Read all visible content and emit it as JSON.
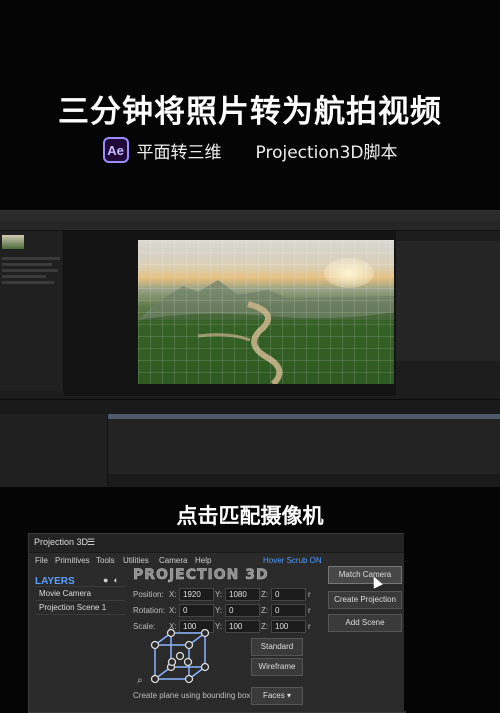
{
  "header": {
    "title": "三分钟将照片转为航拍视频",
    "ae_logo": "Ae",
    "subtitle_left": "平面转三维",
    "subtitle_right": "Projection3D脚本"
  },
  "caption": "点击匹配摄像机",
  "projection_panel": {
    "window_title": "Projection 3D",
    "hamburger_icon": "☰",
    "menu": [
      "File",
      "Primitives",
      "Tools",
      "Utilities",
      "Camera",
      "Help"
    ],
    "hover_scrub": "Hover Scrub ON",
    "layers_title": "LAYERS",
    "layers": [
      "Movie Camera",
      "Projection Scene 1"
    ],
    "logo_text": "PROJECTION 3D",
    "position_label": "Position:",
    "rotation_label": "Rotation:",
    "scale_label": "Scale:",
    "position": {
      "x": "1920",
      "y": "1080",
      "z": "0"
    },
    "rotation": {
      "x": "0",
      "y": "0",
      "z": "0"
    },
    "scale": {
      "x": "100",
      "y": "100",
      "z": "100"
    },
    "axis_x": "X:",
    "axis_y": "Y:",
    "axis_z": "Z:",
    "reset": "r",
    "buttons": {
      "match_camera": "Match Camera",
      "create_projection": "Create Projection",
      "add_scene": "Add Scene",
      "standard": "Standard",
      "wireframe": "Wireframe",
      "faces": "Faces"
    },
    "bounding_box_hint": "Create plane using bounding box"
  },
  "colors": {
    "accent_blue": "#4f9bff",
    "ae_purple": "#9b8cff",
    "background": "#050505"
  }
}
